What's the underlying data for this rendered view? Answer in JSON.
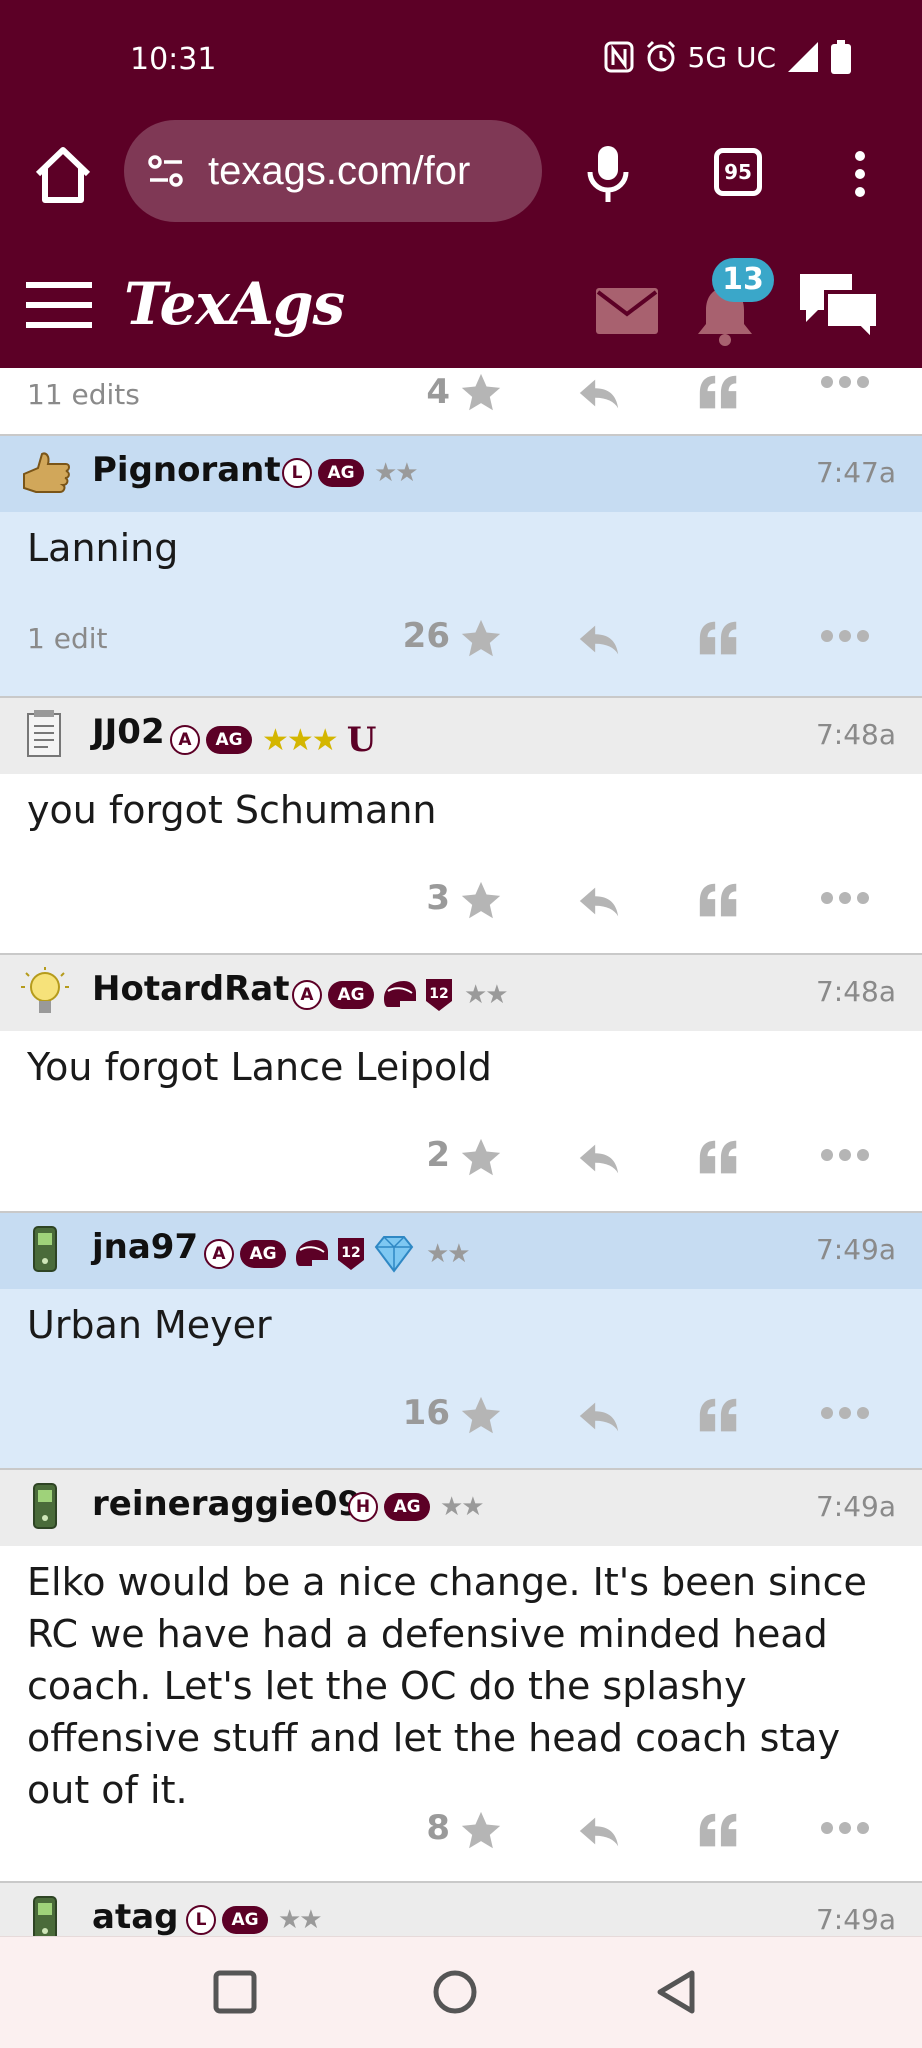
{
  "status": {
    "time": "10:31",
    "network": "5G UC"
  },
  "browser": {
    "url": "texags.com/for",
    "tab_count": "95"
  },
  "site": {
    "logo": "TexAgs",
    "notification_count": "13"
  },
  "edge_row": {
    "edits": "11 edits",
    "likes": "4"
  },
  "posts": [
    {
      "user": "Pignorant",
      "badge_letter": "L",
      "badge_ag": "AG",
      "stars": "★★",
      "time": "7:47a",
      "body": "Lanning",
      "edits": "1 edit",
      "likes": "26"
    },
    {
      "user": "JJ02",
      "badge_letter": "A",
      "badge_ag": "AG",
      "stars": "★★★",
      "extra": "U",
      "time": "7:48a",
      "body": "you forgot Schumann",
      "likes": "3"
    },
    {
      "user": "HotardRat",
      "badge_letter": "A",
      "badge_ag": "AG",
      "twelve": "12",
      "stars": "★★",
      "time": "7:48a",
      "body": "You forgot Lance Leipold",
      "likes": "2"
    },
    {
      "user": "jna97",
      "badge_letter": "A",
      "badge_ag": "AG",
      "twelve": "12",
      "stars": "★★",
      "time": "7:49a",
      "body": "Urban Meyer",
      "likes": "16"
    },
    {
      "user": "reineraggie09",
      "badge_letter": "H",
      "badge_ag": "AG",
      "stars": "★★",
      "time": "7:49a",
      "body": "Elko would be a nice change. It's been since RC we have had a defensive minded head coach. Let's let the OC do the splashy offensive stuff and let the head coach stay out of it.",
      "likes": "8"
    },
    {
      "user": "atag",
      "badge_letter": "L",
      "badge_ag": "AG",
      "stars": "★★",
      "time": "7:49a"
    }
  ],
  "colors": {
    "maroon": "#5c0026",
    "highlight": "#dbeaf9",
    "badge_blue": "#3aa7c9"
  }
}
